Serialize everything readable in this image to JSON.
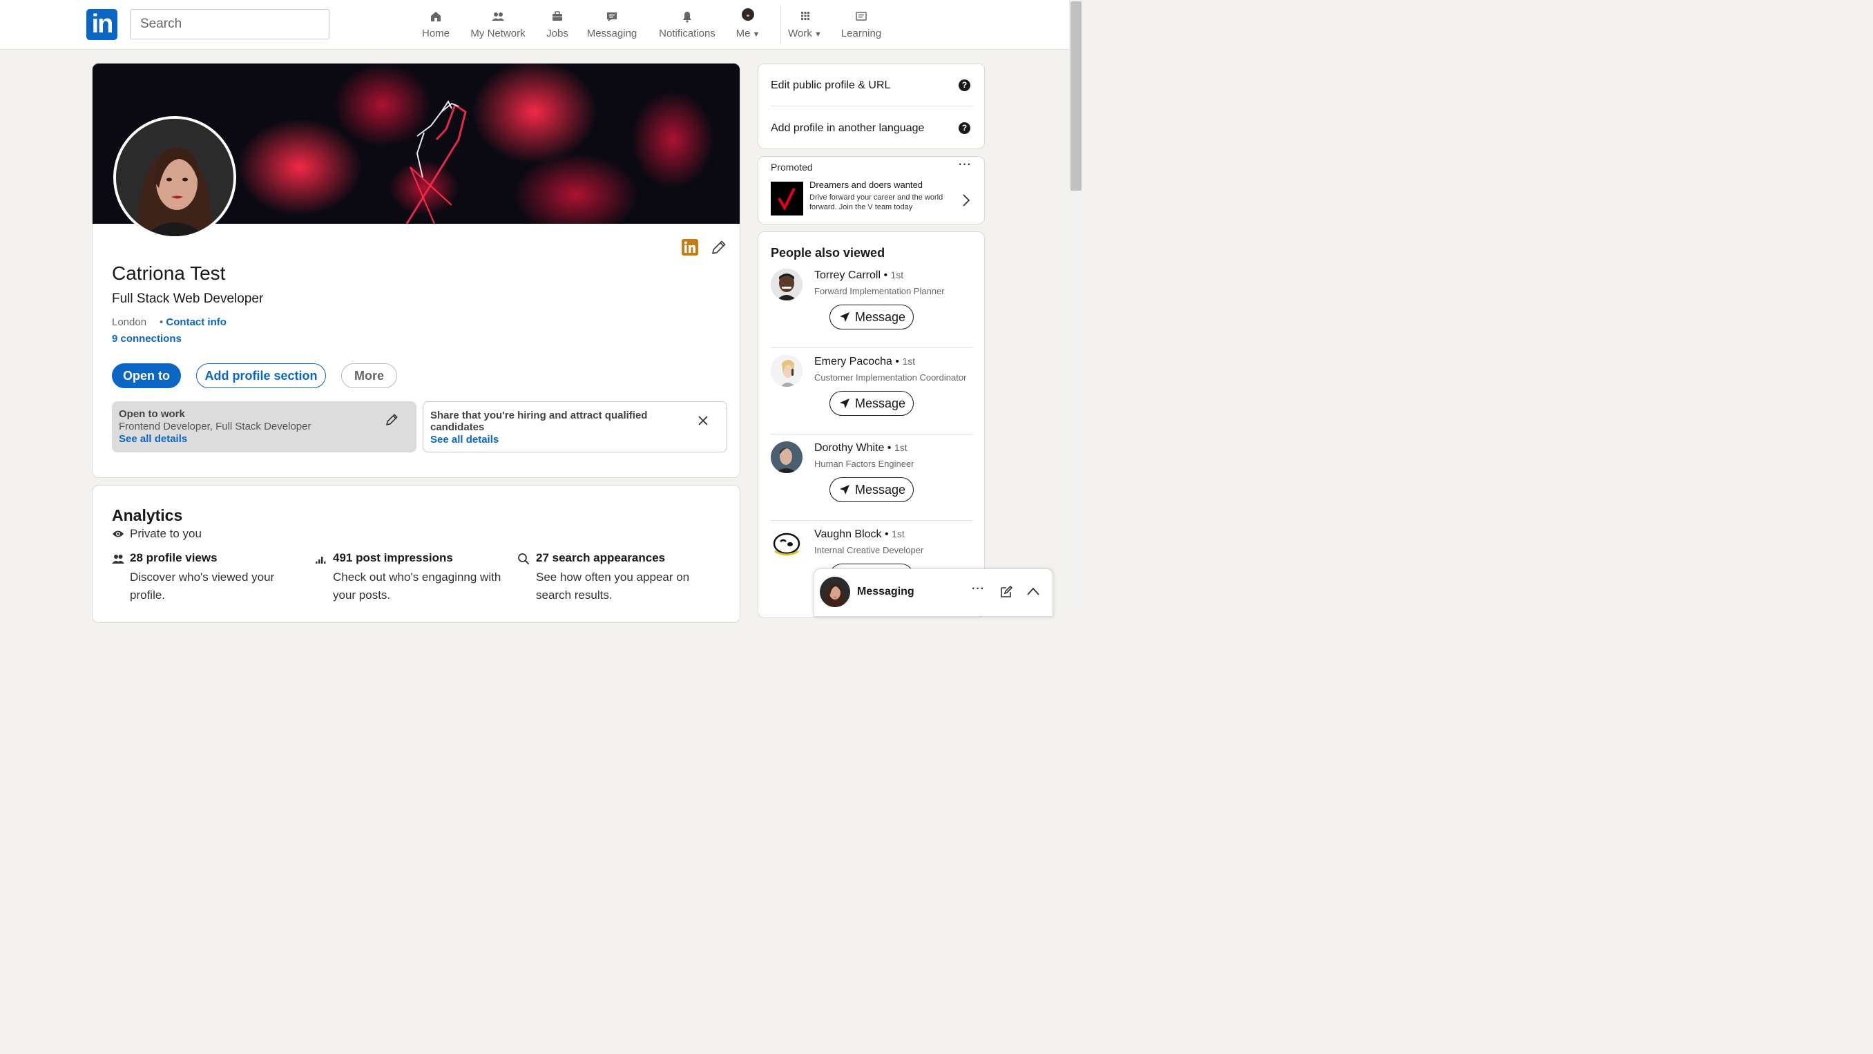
{
  "nav": {
    "search_placeholder": "Search",
    "logo_text": "in",
    "items": [
      {
        "label": "Home",
        "icon": "home-icon"
      },
      {
        "label": "My Network",
        "icon": "network-icon"
      },
      {
        "label": "Jobs",
        "icon": "jobs-icon"
      },
      {
        "label": "Messaging",
        "icon": "messaging-icon"
      },
      {
        "label": "Notifications",
        "icon": "bell-icon"
      },
      {
        "label": "Me",
        "icon": "avatar"
      },
      {
        "label": "Work",
        "icon": "grid-icon"
      },
      {
        "label": "Learning",
        "icon": "learning-icon"
      }
    ]
  },
  "profile": {
    "name": "Catriona Test",
    "headline": "Full Stack Web Developer",
    "location": "London",
    "contact_info": "Contact info",
    "connections": "9 connections",
    "buttons": {
      "open_to": "Open to",
      "add_section": "Add profile section",
      "more": "More"
    },
    "open_to_work": {
      "title": "Open to work",
      "roles": "Frontend Developer, Full Stack Developer",
      "link": "See all details"
    },
    "hiring": {
      "text": "Share that you're hiring and attract qualified candidates",
      "link": "See all details"
    }
  },
  "analytics": {
    "title": "Analytics",
    "privacy": "Private to you",
    "stats": [
      {
        "headline": "28 profile views",
        "desc": "Discover who's viewed your profile."
      },
      {
        "headline": "491 post impressions",
        "desc": "Check out who's engaginng with your posts."
      },
      {
        "headline": "27 search appearances",
        "desc": "See how often you appear on search results."
      }
    ]
  },
  "sidebar": {
    "edit_profile": "Edit public profile & URL",
    "add_language": "Add profile in another language",
    "promo": {
      "label": "Promoted",
      "title": "Dreamers and doers wanted",
      "body": "Drive forward your career and the world forward. Join the V team today"
    },
    "people_title": "People also viewed",
    "people": [
      {
        "name": "Torrey Carroll",
        "degree": "1st",
        "title": "Forward Implementation Planner"
      },
      {
        "name": "Emery Pacocha",
        "degree": "1st",
        "title": "Customer Implementation Coordinator"
      },
      {
        "name": "Dorothy White",
        "degree": "1st",
        "title": "Human Factors Engineer"
      },
      {
        "name": "Vaughn Block",
        "degree": "1st",
        "title": "Internal Creative Developer"
      }
    ],
    "message_label": "Message"
  },
  "messaging_bar": {
    "label": "Messaging"
  },
  "colors": {
    "brand": "#0a66c2",
    "background": "#f3f2ef",
    "banner_accent": "#ff2a4a"
  }
}
